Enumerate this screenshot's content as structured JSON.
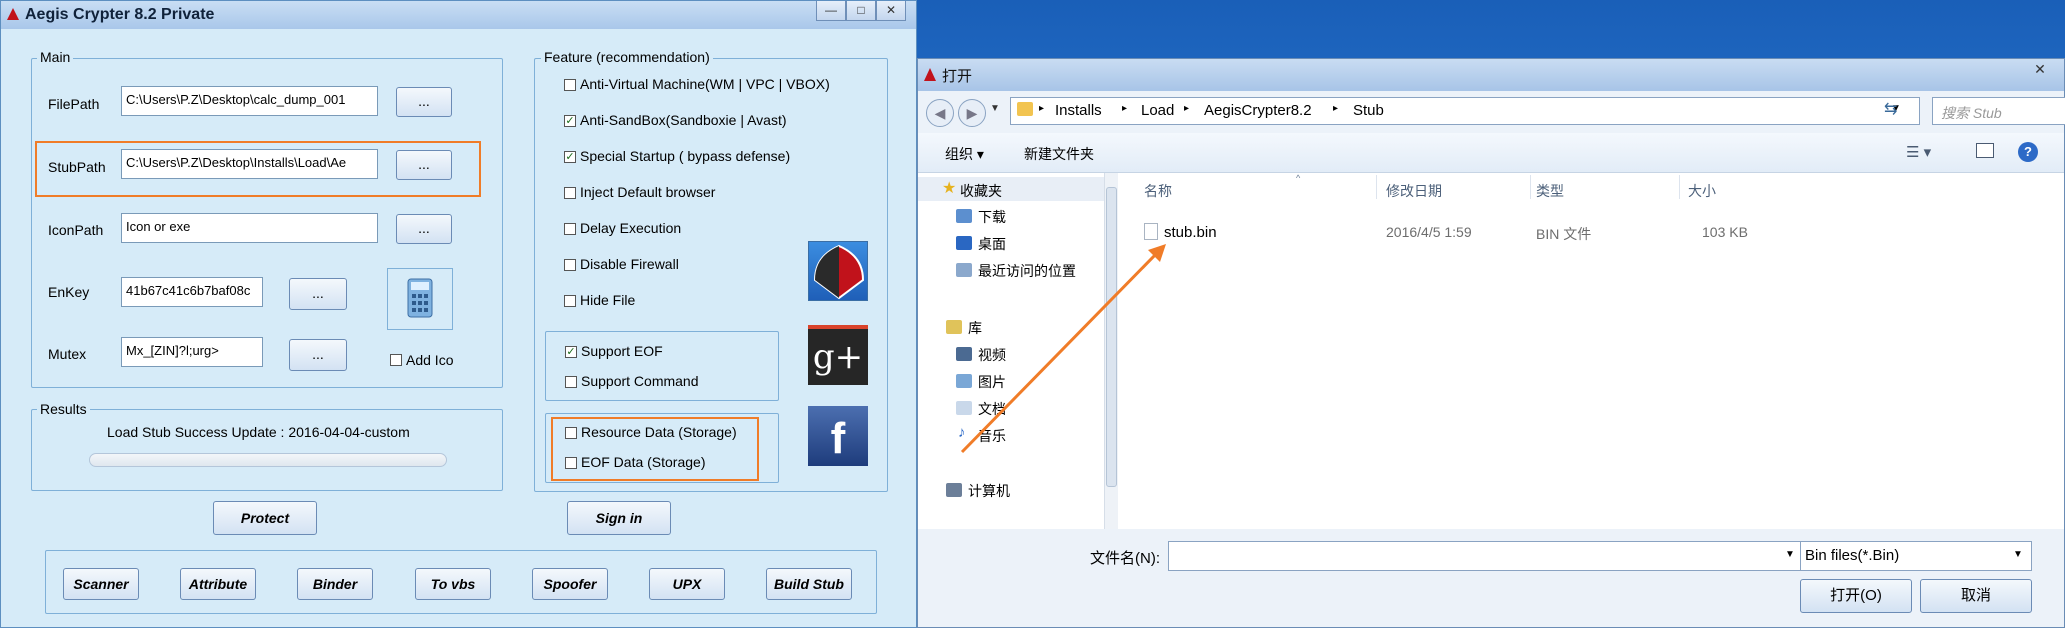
{
  "aegis": {
    "title": "Aegis Crypter 8.2  Private",
    "window_buttons": [
      "—",
      "□",
      "✕"
    ],
    "main_group": "Main",
    "filepath_label": "FilePath",
    "filepath_value": "C:\\Users\\P.Z\\Desktop\\calc_dump_001",
    "stubpath_label": "StubPath",
    "stubpath_value": "C:\\Users\\P.Z\\Desktop\\Installs\\Load\\Ae",
    "iconpath_label": "IconPath",
    "iconpath_value": "Icon or exe",
    "enkey_label": "EnKey",
    "enkey_value": "41b67c41c6b7baf08c",
    "mutex_label": "Mutex",
    "mutex_value": "Mx_[ZIN]?l;urg>",
    "browse_label": "...",
    "add_ico_label": "Add Ico",
    "results_group": "Results",
    "results_text": "Load Stub Success Update : 2016-04-04-custom",
    "protect_label": "Protect",
    "signin_label": "Sign in",
    "feature_group": "Feature (recommendation)",
    "features": [
      {
        "label": "Anti-Virtual Machine(WM | VPC | VBOX)",
        "checked": false
      },
      {
        "label": "Anti-SandBox(Sandboxie | Avast)",
        "checked": true
      },
      {
        "label": "Special Startup ( bypass defense)",
        "checked": true
      },
      {
        "label": "Inject Default browser",
        "checked": false
      },
      {
        "label": "Delay Execution",
        "checked": false
      },
      {
        "label": "Disable Firewall",
        "checked": false
      },
      {
        "label": "Hide File",
        "checked": false
      }
    ],
    "support_eof": "Support EOF",
    "support_command": "Support Command",
    "resource_data": "Resource Data (Storage)",
    "eof_data": "EOF Data (Storage)",
    "google_plus": "g+",
    "facebook": "f",
    "bottom_buttons": [
      "Scanner",
      "Attribute",
      "Binder",
      "To vbs",
      "Spoofer",
      "UPX",
      "Build Stub"
    ]
  },
  "dialog": {
    "title": "打开",
    "breadcrumb": [
      "Installs",
      "Load",
      "AegisCrypter8.2",
      "Stub"
    ],
    "search_placeholder": "搜索 Stub",
    "organize": "组织 ▾",
    "new_folder": "新建文件夹",
    "nav": {
      "favorites": "收藏夹",
      "downloads": "下载",
      "desktop": "桌面",
      "recent": "最近访问的位置",
      "libraries": "库",
      "videos": "视频",
      "pictures": "图片",
      "documents": "文档",
      "music": "音乐",
      "computer": "计算机"
    },
    "columns": {
      "name": "名称",
      "date": "修改日期",
      "type": "类型",
      "size": "大小"
    },
    "file": {
      "name": "stub.bin",
      "date": "2016/4/5 1:59",
      "type": "BIN 文件",
      "size": "103 KB"
    },
    "filename_label": "文件名(N):",
    "filter": "Bin   files(*.Bin)",
    "open_button": "打开(O)",
    "cancel_button": "取消",
    "close": "✕"
  },
  "colors": {
    "accent_orange": "#f07c28",
    "window_bg": "#d6ebf8",
    "desktop": "#1f66c2"
  }
}
